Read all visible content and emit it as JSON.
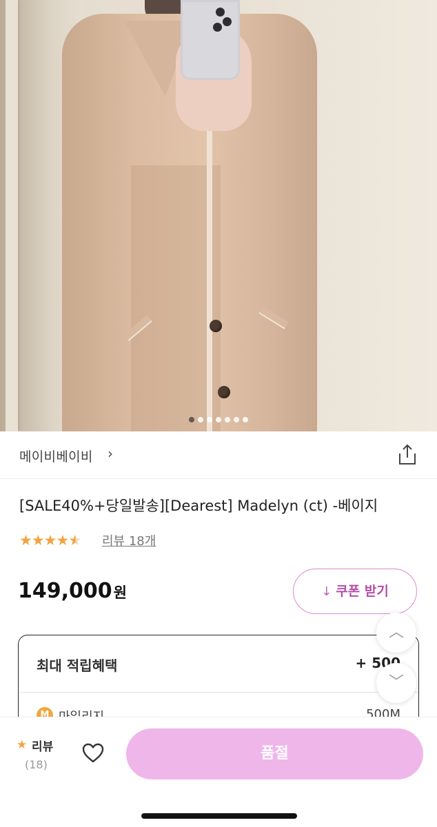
{
  "hero": {
    "page_dots": 7,
    "active_dot": 0
  },
  "brand": {
    "name": "메이비베이비",
    "chevron": "›",
    "share_icon": "share-icon"
  },
  "product": {
    "title": "[SALE40%+당일발송][Dearest] Madelyn (ct) -베이지",
    "rating_stars": 4.5,
    "review_link": "리뷰 18개",
    "price": "149,000",
    "price_unit": "원"
  },
  "coupon": {
    "icon": "↓",
    "label": "쿠폰 받기"
  },
  "benefits": {
    "title": "최대 적립혜택",
    "value": "+ 500",
    "mileage_icon": "M",
    "mileage_label": "마일리지",
    "mileage_value": "500M"
  },
  "scroll": {
    "up": "︿",
    "down": "﹀"
  },
  "bottom_bar": {
    "review_label": "리뷰",
    "review_count": "(18)",
    "soldout_label": "품절"
  },
  "colors": {
    "star": "#f3a33f",
    "coupon_text": "#b34ea6",
    "coupon_border": "#d98ad0",
    "soldout_bg": "#efb6ea"
  }
}
